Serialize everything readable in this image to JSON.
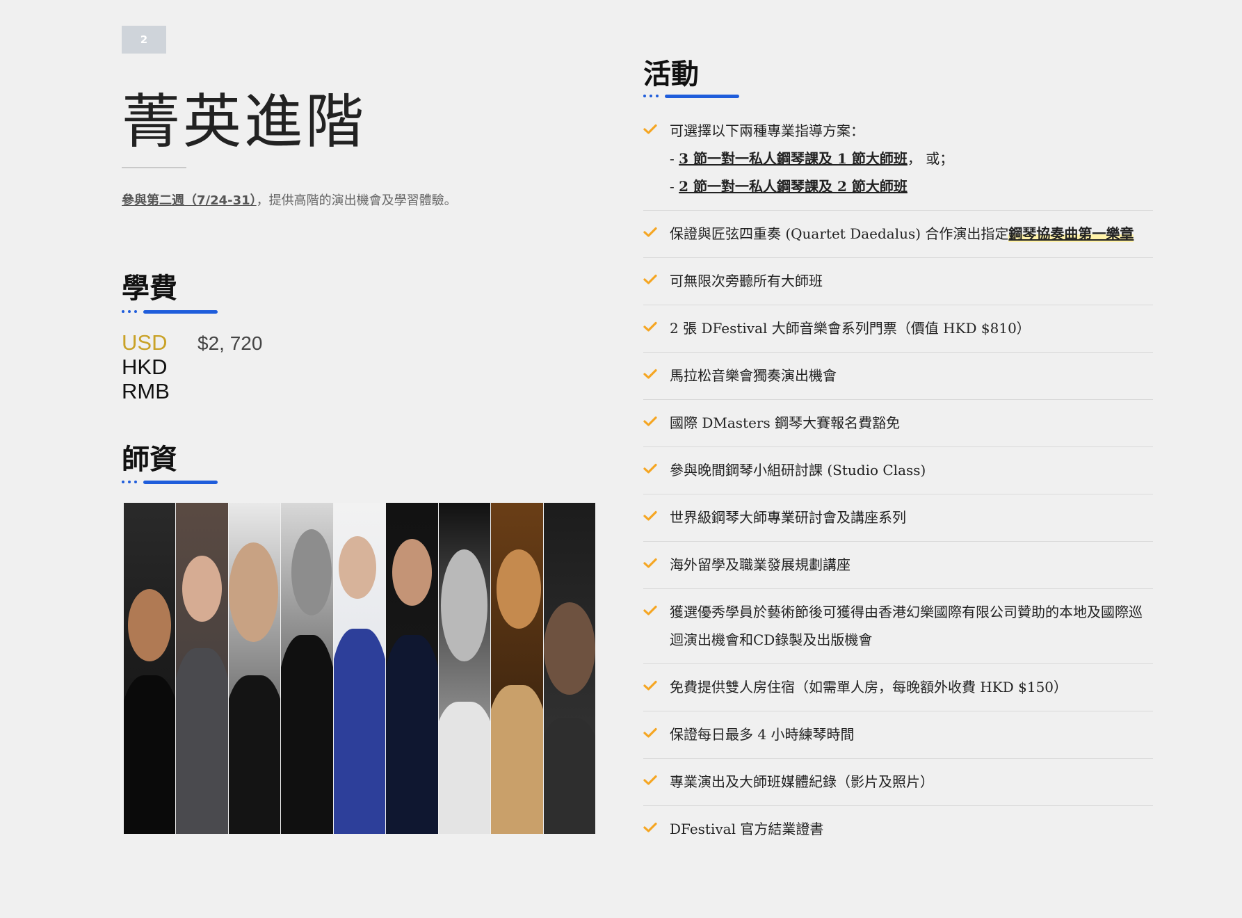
{
  "page_number": "2",
  "title": "菁英進階",
  "intro": {
    "link_text": "參與第二週（7/24-31）",
    "text": "，提供高階的演出機會及學習體驗。"
  },
  "tuition": {
    "heading": "學費",
    "rows": [
      {
        "currency": "USD",
        "amount": "$2, 720"
      },
      {
        "currency": "HKD",
        "amount": ""
      },
      {
        "currency": "RMB",
        "amount": ""
      }
    ]
  },
  "faculty": {
    "heading": "師資",
    "portrait_count": 9
  },
  "activities": {
    "heading": "活動",
    "items": [
      {
        "text": "可選擇以下兩種專業指導方案：",
        "sub": [
          {
            "prefix": "- ",
            "underlined": "3 節一對一私人鋼琴課及 1 節大師班",
            "suffix": "， 或；"
          },
          {
            "prefix": "- ",
            "underlined": "2 節一對一私人鋼琴課及 2 節大師班",
            "suffix": ""
          }
        ]
      },
      {
        "text": "保證與匠弦四重奏 (Quartet Daedalus) 合作演出指定",
        "highlight": "鋼琴協奏曲第一樂章"
      },
      {
        "text": "可無限次旁聽所有大師班"
      },
      {
        "text": "2 張 DFestival 大師音樂會系列門票（價值 HKD $810）"
      },
      {
        "text": "馬拉松音樂會獨奏演出機會"
      },
      {
        "text": "國際 DMasters 鋼琴大賽報名費豁免"
      },
      {
        "text": "參與晚間鋼琴小組研討課 (Studio Class)"
      },
      {
        "text": "世界級鋼琴大師專業研討會及講座系列"
      },
      {
        "text": "海外留學及職業發展規劃講座"
      },
      {
        "text": "獲選優秀學員於藝術節後可獲得由香港幻樂國際有限公司贊助的本地及國際巡迴演出機會和CD錄製及出版機會"
      },
      {
        "text": "免費提供雙人房住宿（如需單人房，每晚額外收費 HKD $150）"
      },
      {
        "text": "保證每日最多 4 小時練琴時間"
      },
      {
        "text": "專業演出及大師班媒體紀錄（影片及照片）"
      },
      {
        "text": "DFestival 官方結業證書"
      }
    ]
  },
  "colors": {
    "accent_blue": "#1f5ddb",
    "check_orange": "#f5a623",
    "usd_gold": "#c9a227",
    "highlight_yellow": "#fff2a8"
  }
}
